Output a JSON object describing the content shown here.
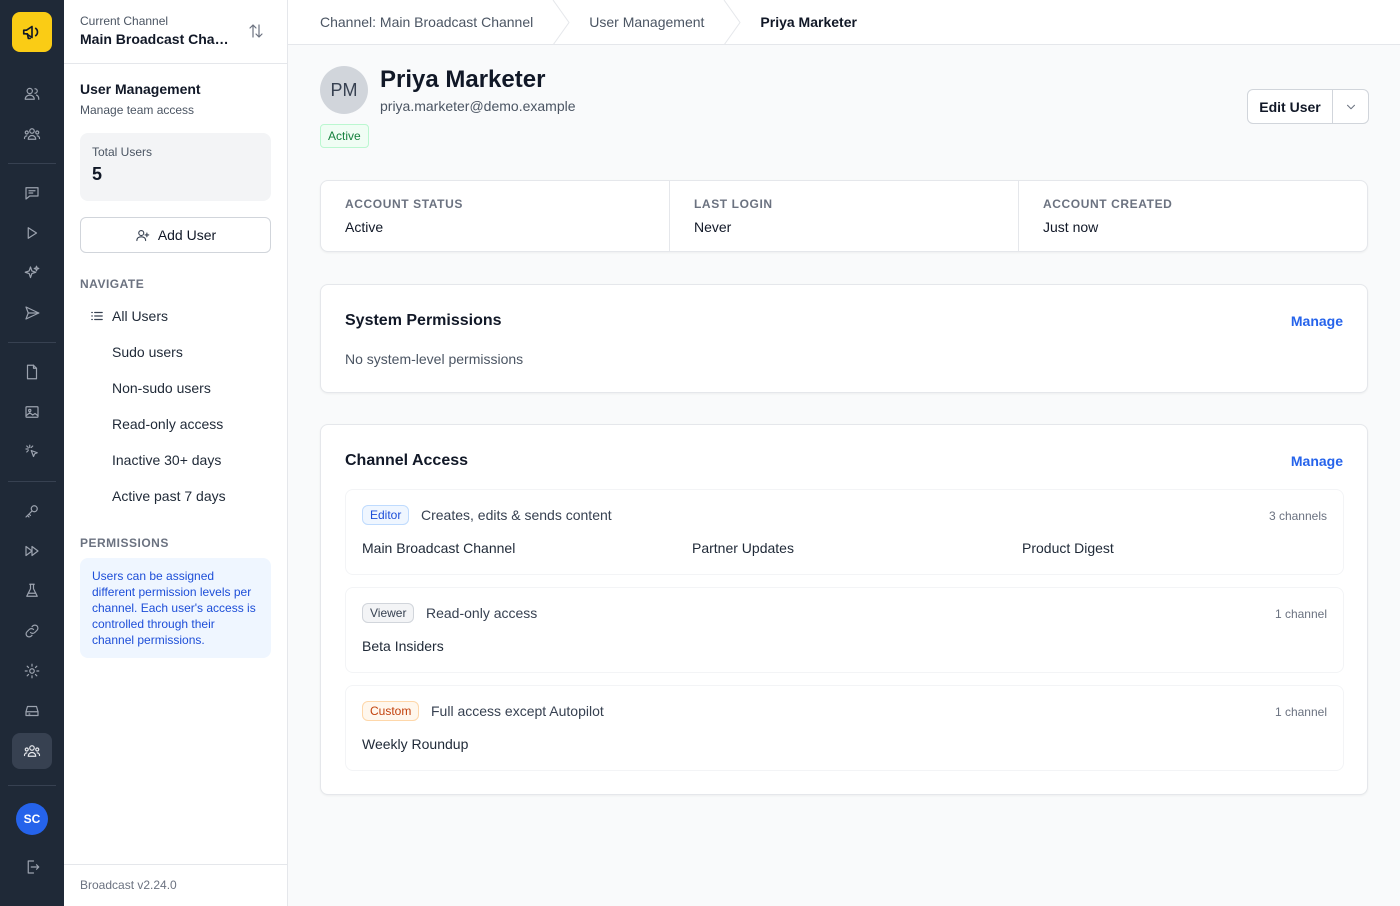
{
  "sidebar": {
    "channel_label": "Current Channel",
    "channel_name": "Main Broadcast Channel",
    "section_title": "User Management",
    "section_subtitle": "Manage team access",
    "total_users_label": "Total Users",
    "total_users_value": "5",
    "add_user_label": "Add User",
    "navigate_heading": "NAVIGATE",
    "nav_items": [
      "All Users",
      "Sudo users",
      "Non-sudo users",
      "Read-only access",
      "Inactive 30+ days",
      "Active past 7 days"
    ],
    "permissions_heading": "PERMISSIONS",
    "permissions_note": "Users can be assigned different permission levels per channel. Each user's access is controlled through their channel permissions.",
    "version": "Broadcast v2.24.0"
  },
  "rail": {
    "avatar_initials": "SC",
    "icons": [
      "megaphone-icon",
      "users-icon",
      "team-icon",
      "chat-icon",
      "play-icon",
      "sparkles-icon",
      "send-icon",
      "document-icon",
      "image-icon",
      "cursor-click-icon",
      "key-icon",
      "fast-forward-icon",
      "flask-icon",
      "link-icon",
      "gear-icon",
      "server-icon",
      "user-group-icon",
      "logout-icon"
    ]
  },
  "breadcrumb": [
    "Channel: Main Broadcast Channel",
    "User Management",
    "Priya Marketer"
  ],
  "user": {
    "initials": "PM",
    "name": "Priya Marketer",
    "email": "priya.marketer@demo.example",
    "status": "Active",
    "edit_label": "Edit User"
  },
  "stats": [
    {
      "label": "ACCOUNT STATUS",
      "value": "Active"
    },
    {
      "label": "LAST LOGIN",
      "value": "Never"
    },
    {
      "label": "ACCOUNT CREATED",
      "value": "Just now"
    }
  ],
  "system_permissions": {
    "title": "System Permissions",
    "manage_label": "Manage",
    "empty_text": "No system-level permissions"
  },
  "channel_access": {
    "title": "Channel Access",
    "manage_label": "Manage",
    "groups": [
      {
        "role": "Editor",
        "description": "Creates, edits & sends content",
        "count": "3 channels",
        "channels": [
          "Main Broadcast Channel",
          "Partner Updates",
          "Product Digest"
        ]
      },
      {
        "role": "Viewer",
        "description": "Read-only access",
        "count": "1 channel",
        "channels": [
          "Beta Insiders"
        ]
      },
      {
        "role": "Custom",
        "description": "Full access except Autopilot",
        "count": "1 channel",
        "channels": [
          "Weekly Roundup"
        ]
      }
    ]
  }
}
